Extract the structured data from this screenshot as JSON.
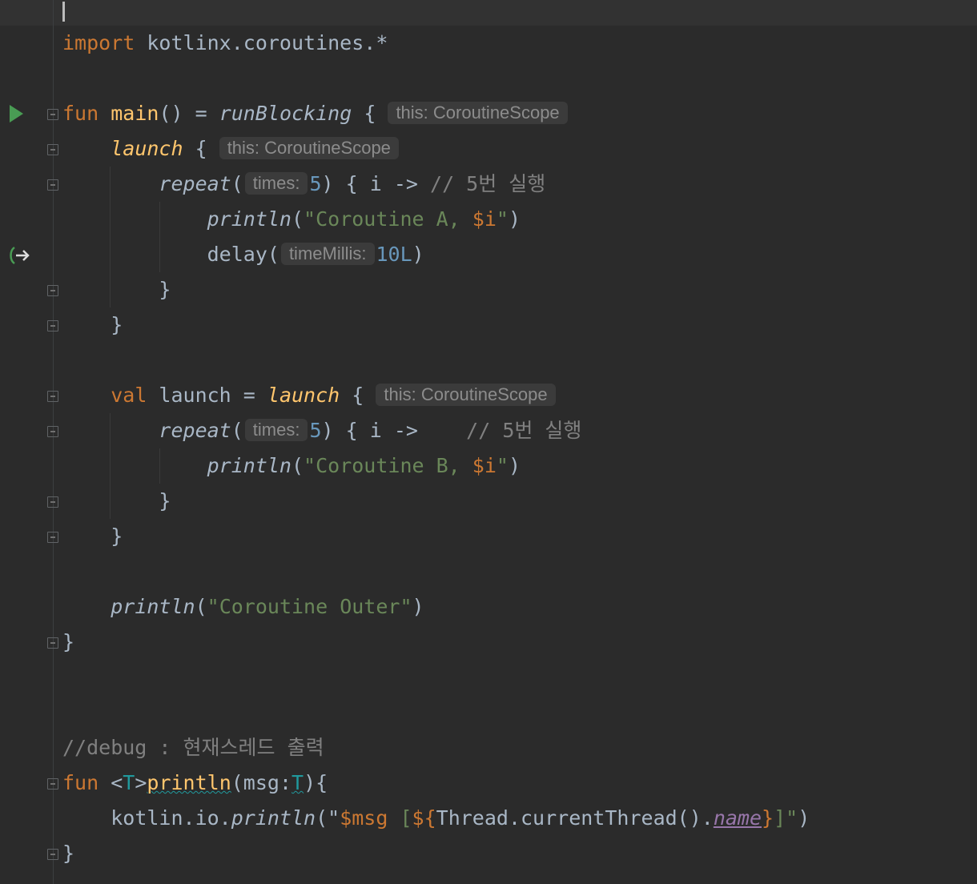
{
  "editor": {
    "language": "kotlin",
    "colors": {
      "background": "#2b2b2b",
      "keyword": "#cc7832",
      "function": "#ffc66d",
      "string": "#6a8759",
      "number": "#6897bb",
      "comment": "#808080",
      "run_icon": "#499c54"
    },
    "gutter_icons": [
      "run-icon",
      "suspend-call-icon",
      "fold-icon"
    ],
    "lines": {
      "import_kw": "import",
      "import_path": " kotlinx.coroutines.*",
      "main_fun_kw": "fun",
      "main_name": "main",
      "main_rest": "() = ",
      "run_blocking": "runBlocking",
      "open_brace": " { ",
      "hint_scope_main": "this: CoroutineScope",
      "launch1": "launch",
      "hint_scope_launch1": "this: CoroutineScope",
      "repeat1": "repeat",
      "paren_open": "(",
      "hint_times": "times:",
      "hint_times_2": "times:",
      "repeat_count": "5",
      "repeat_tail1": ") { i ->",
      "comment1": "// 5번 실행",
      "println_a": "println",
      "str_a_open": "\"Coroutine A, ",
      "str_a_var": "$i",
      "str_a_close": "\"",
      "close_paren": ")",
      "delay": "delay(",
      "hint_timemillis": "timeMillis:",
      "delay_value": "10L",
      "brace_close": "}",
      "val_kw": "val",
      "val_name": " launch = ",
      "launch2": "launch",
      "hint_scope_launch2": "this: CoroutineScope",
      "repeat2": "repeat",
      "repeat_tail2": ") { i ->    ",
      "comment2": "// 5번 실행",
      "println_b": "println",
      "str_b_open": "\"Coroutine B, ",
      "str_b_var": "$i",
      "str_b_close": "\"",
      "println_outer": "println",
      "str_outer": "\"Coroutine Outer\"",
      "debug_comment": "//debug : 현재스레드 출력",
      "fun2_kw": "fun",
      "generic_open": " <",
      "type_param": "T",
      "generic_close": ">",
      "println_def": "println",
      "param_sig": "(msg:",
      "param_type": "T",
      "sig_close": "){",
      "body_prefix": "kotlin.io.",
      "body_println": "println",
      "body_str_open": "(\"",
      "body_msg_var": "$msg",
      "body_str_mid": " [",
      "body_template_open": "${",
      "body_thread": "Thread.currentThread().",
      "body_name_prop": "name",
      "body_template_close": "}",
      "body_str_close": "]\"",
      "body_paren_close": ")"
    }
  }
}
